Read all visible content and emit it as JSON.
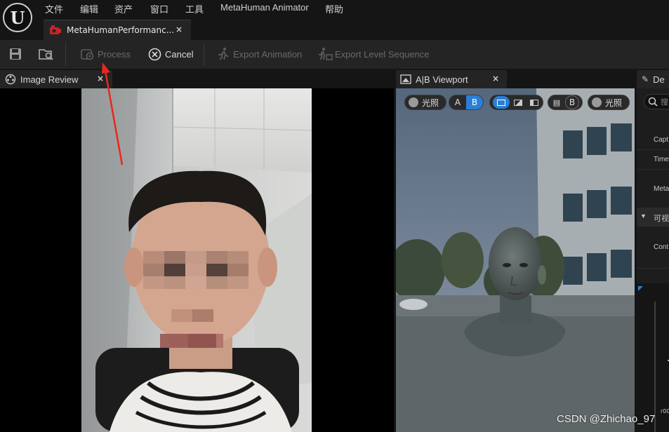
{
  "menu": {
    "items": [
      "文件",
      "编辑",
      "资产",
      "窗口",
      "工具",
      "MetaHuman Animator",
      "帮助"
    ]
  },
  "document_tab": {
    "label": "MetaHumanPerformanc...",
    "close": "×"
  },
  "toolbar": {
    "save_icon": "save-icon",
    "browse_icon": "browse-asset-icon",
    "process_label": "Process",
    "cancel_label": "Cancel",
    "export_animation_label": "Export Animation",
    "export_level_sequence_label": "Export Level Sequence"
  },
  "image_review": {
    "title": "Image Review",
    "close": "×"
  },
  "ab_viewport": {
    "title": "A|B Viewport",
    "close": "×",
    "lit_label_left": "光照",
    "a_label": "A",
    "b_label": "B",
    "b_label_right": "B",
    "lit_label_right": "光照"
  },
  "details": {
    "title": "De",
    "search_placeholder": "搜",
    "rows": [
      "Capt",
      "Time",
      "Meta"
    ],
    "section": "可视",
    "section_rows": [
      "Cont"
    ]
  },
  "watermark": "CSDN @Zhichao_97",
  "timeline_readout": "r00",
  "colors": {
    "accent_blue": "#2a7fd4",
    "annotation_arrow": "#e8281e",
    "panel_bg": "#242424",
    "app_bg": "#151515"
  }
}
